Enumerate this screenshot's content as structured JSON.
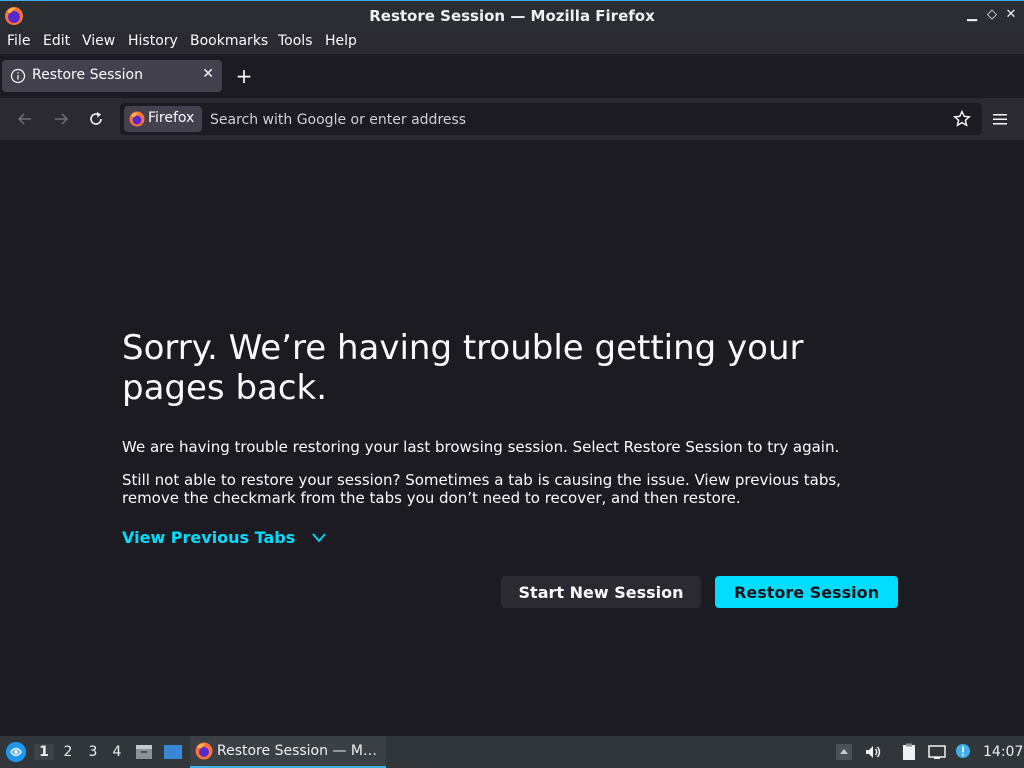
{
  "window": {
    "title": "Restore Session — Mozilla Firefox",
    "controls": [
      "minimize",
      "maximize",
      "close"
    ]
  },
  "menubar": {
    "items": [
      {
        "label": "File",
        "accel": "F"
      },
      {
        "label": "Edit",
        "accel": "E"
      },
      {
        "label": "View",
        "accel": "V"
      },
      {
        "label": "History",
        "accel": "s"
      },
      {
        "label": "Bookmarks",
        "accel": "B"
      },
      {
        "label": "Tools",
        "accel": "T"
      },
      {
        "label": "Help",
        "accel": "H"
      }
    ]
  },
  "tabs": [
    {
      "label": "Restore Session",
      "icon": "info-icon",
      "active": true
    }
  ],
  "navbar": {
    "identity_label": "Firefox",
    "url_placeholder": "Search with Google or enter address",
    "url_value": ""
  },
  "page": {
    "heading": "Sorry. We’re having trouble getting your pages back.",
    "para1": "We are having trouble restoring your last browsing session. Select Restore Session to try again.",
    "para2": "Still not able to restore your session? Sometimes a tab is causing the issue. View previous tabs, remove the checkmark from the tabs you don’t need to recover, and then restore.",
    "view_previous_label": "View Previous Tabs",
    "start_new_label": "Start New Session",
    "start_new_accel": "N",
    "restore_label": "Restore Session",
    "restore_accel": "R"
  },
  "taskbar": {
    "desktops": [
      "1",
      "2",
      "3",
      "4"
    ],
    "active_desktop": "1",
    "task_label": "Restore Session — M…",
    "clock": "14:07"
  },
  "colors": {
    "accent": "#00ddff",
    "page_bg": "#1c1b22",
    "toolbar_bg": "#2b2a33",
    "kde_highlight": "#3daee9"
  }
}
